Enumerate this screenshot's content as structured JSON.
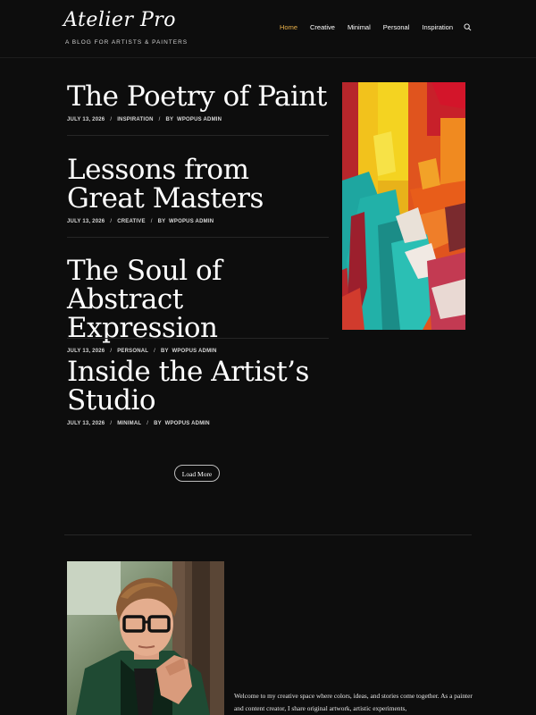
{
  "site": {
    "title": "Atelier Pro",
    "tagline": "A BLOG FOR ARTISTS & PAINTERS"
  },
  "nav": {
    "items": [
      {
        "label": "Home",
        "active": true
      },
      {
        "label": "Creative",
        "active": false
      },
      {
        "label": "Minimal",
        "active": false
      },
      {
        "label": "Personal",
        "active": false
      },
      {
        "label": "Inspiration",
        "active": false
      }
    ],
    "search_icon": "search-icon"
  },
  "posts": [
    {
      "title": "The Poetry of Paint",
      "date": "JULY 13, 2026",
      "category": "INSPIRATION",
      "by": "BY",
      "author": "WPOPUS ADMIN"
    },
    {
      "title": "Lessons from Great Masters",
      "date": "JULY 13, 2026",
      "category": "CREATIVE",
      "by": "BY",
      "author": "WPOPUS ADMIN"
    },
    {
      "title": "The Soul of Abstract Expression",
      "date": "JULY 13, 2026",
      "category": "PERSONAL",
      "by": "BY",
      "author": "WPOPUS ADMIN"
    },
    {
      "title": "Inside the Artist’s Studio",
      "date": "JULY 13, 2026",
      "category": "MINIMAL",
      "by": "BY",
      "author": "WPOPUS ADMIN"
    }
  ],
  "meta_separator": "/",
  "load_more_label": "Load More",
  "about": {
    "text": "Welcome to my creative space where colors, ideas, and stories come together. As a painter and content creator, I share original artwork, artistic experiments,"
  },
  "colors": {
    "background": "#0d0d0d",
    "accent": "#e8b04a",
    "text": "#ffffff",
    "divider": "#262626"
  }
}
